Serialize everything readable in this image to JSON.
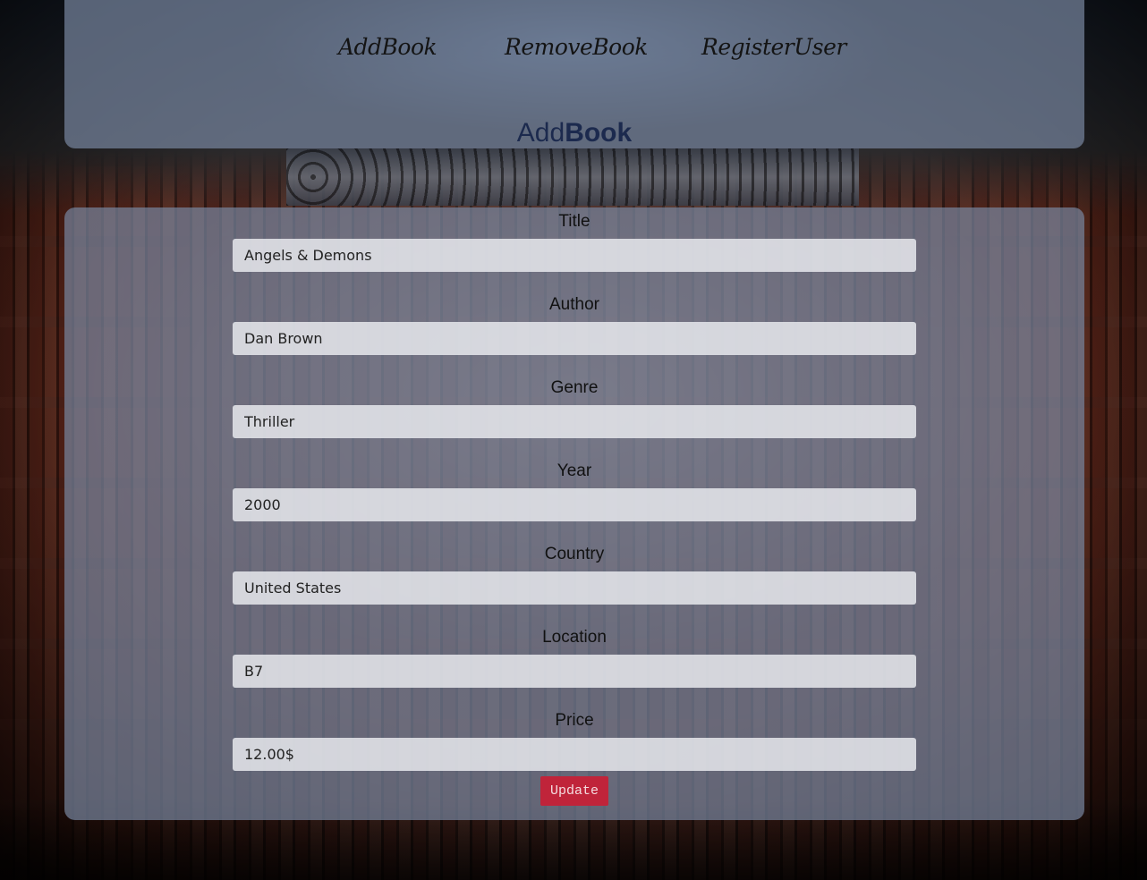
{
  "nav": {
    "add_book": "AddBook",
    "remove_book": "RemoveBook",
    "register_user": "RegisterUser"
  },
  "page_title": {
    "prefix": "Add",
    "bold": "Book"
  },
  "form": {
    "fields": [
      {
        "label": "Title",
        "value": "Angels & Demons"
      },
      {
        "label": "Author",
        "value": "Dan Brown"
      },
      {
        "label": "Genre",
        "value": "Thriller"
      },
      {
        "label": "Year",
        "value": "2000"
      },
      {
        "label": "Country",
        "value": "United States"
      },
      {
        "label": "Location",
        "value": "B7"
      },
      {
        "label": "Price",
        "value": "12.00$"
      }
    ],
    "submit_label": "Update"
  },
  "colors": {
    "panel": "#76849c",
    "title": "#1c2a4e",
    "button": "#c0243a"
  }
}
